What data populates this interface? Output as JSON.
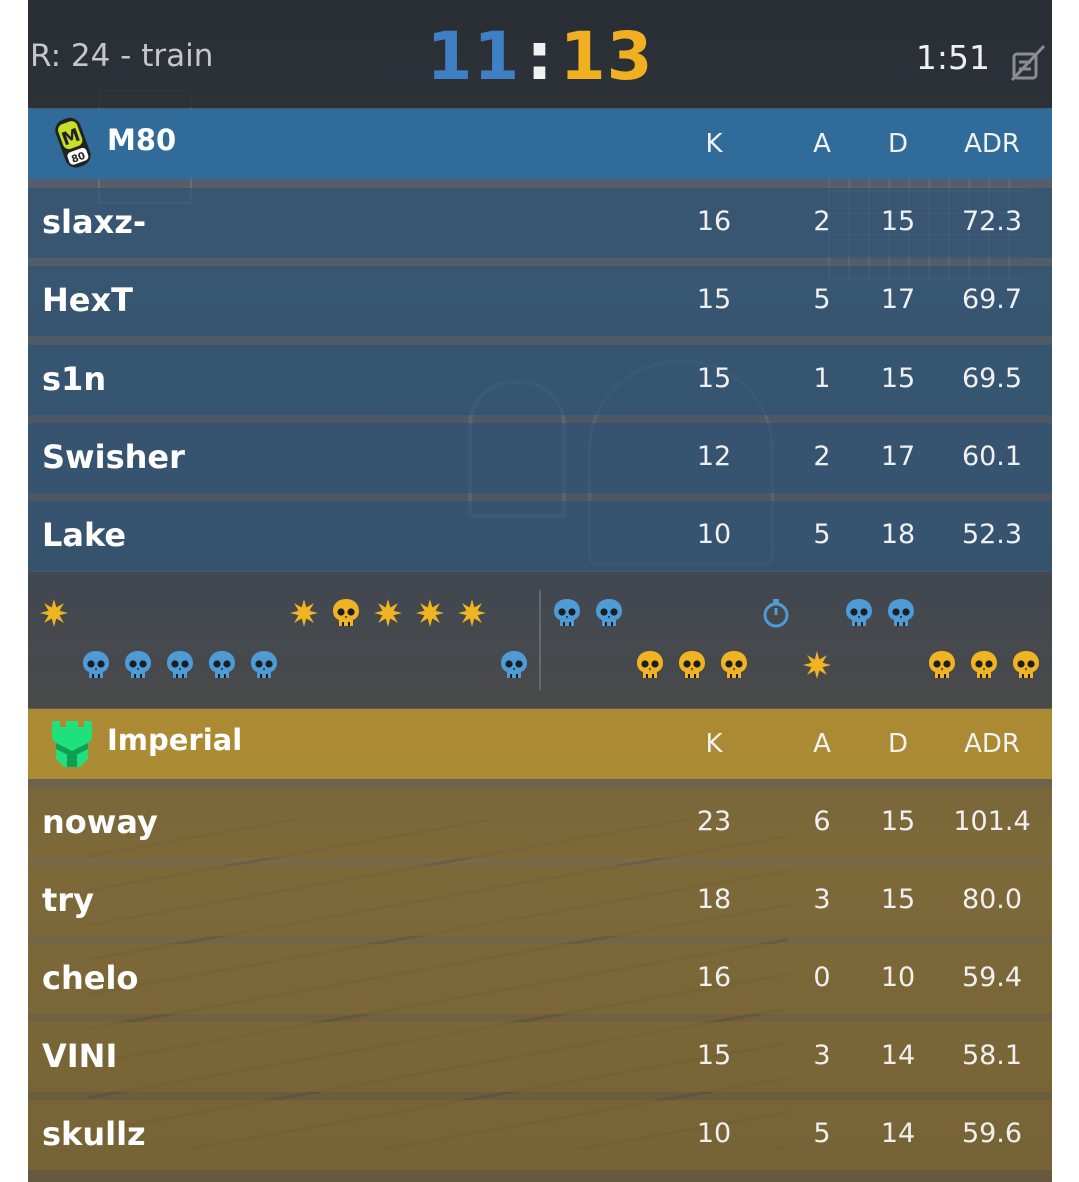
{
  "header": {
    "round_info": "R: 24 - train",
    "score_left": "11",
    "score_sep": ":",
    "score_right": "13",
    "timer": "1:51",
    "icons": [
      "bomb-defused-icon"
    ]
  },
  "columns": {
    "k": "K",
    "a": "A",
    "d": "D",
    "adr": "ADR"
  },
  "teams": [
    {
      "name": "M80",
      "side_color": "#2e6c9e",
      "logo": "m80-logo",
      "players": [
        {
          "name": "slaxz-",
          "k": "16",
          "a": "2",
          "d": "15",
          "adr": "72.3"
        },
        {
          "name": "HexT",
          "k": "15",
          "a": "5",
          "d": "17",
          "adr": "69.7"
        },
        {
          "name": "s1n",
          "k": "15",
          "a": "1",
          "d": "15",
          "adr": "69.5"
        },
        {
          "name": "Swisher",
          "k": "12",
          "a": "2",
          "d": "17",
          "adr": "60.1"
        },
        {
          "name": "Lake",
          "k": "10",
          "a": "5",
          "d": "18",
          "adr": "52.3"
        }
      ]
    },
    {
      "name": "Imperial",
      "side_color": "#b08e32",
      "logo": "imperial-logo",
      "players": [
        {
          "name": "noway",
          "k": "23",
          "a": "6",
          "d": "15",
          "adr": "101.4"
        },
        {
          "name": "try",
          "k": "18",
          "a": "3",
          "d": "15",
          "adr": "80.0"
        },
        {
          "name": "chelo",
          "k": "16",
          "a": "0",
          "d": "10",
          "adr": "59.4"
        },
        {
          "name": "VINI",
          "k": "15",
          "a": "3",
          "d": "14",
          "adr": "58.1"
        },
        {
          "name": "skullz",
          "k": "10",
          "a": "5",
          "d": "14",
          "adr": "59.6"
        }
      ]
    }
  ],
  "round_history": {
    "colors": {
      "ct": "#4e9bd6",
      "t": "#f0b422"
    },
    "top_row": [
      "bomb-explode-gold",
      "bomb-explode-gold",
      "skull-gold",
      "bomb-explode-gold",
      "bomb-explode-gold",
      "bomb-explode-gold",
      "skull-blue",
      "skull-blue",
      "stopwatch-blue",
      "skull-blue",
      "skull-blue"
    ],
    "bottom_row": [
      "skull-blue",
      "skull-blue",
      "skull-blue",
      "skull-blue",
      "skull-blue",
      "skull-blue",
      "skull-gold",
      "skull-gold",
      "skull-gold",
      "bomb-explode-gold",
      "skull-gold",
      "skull-gold",
      "skull-gold"
    ]
  }
}
